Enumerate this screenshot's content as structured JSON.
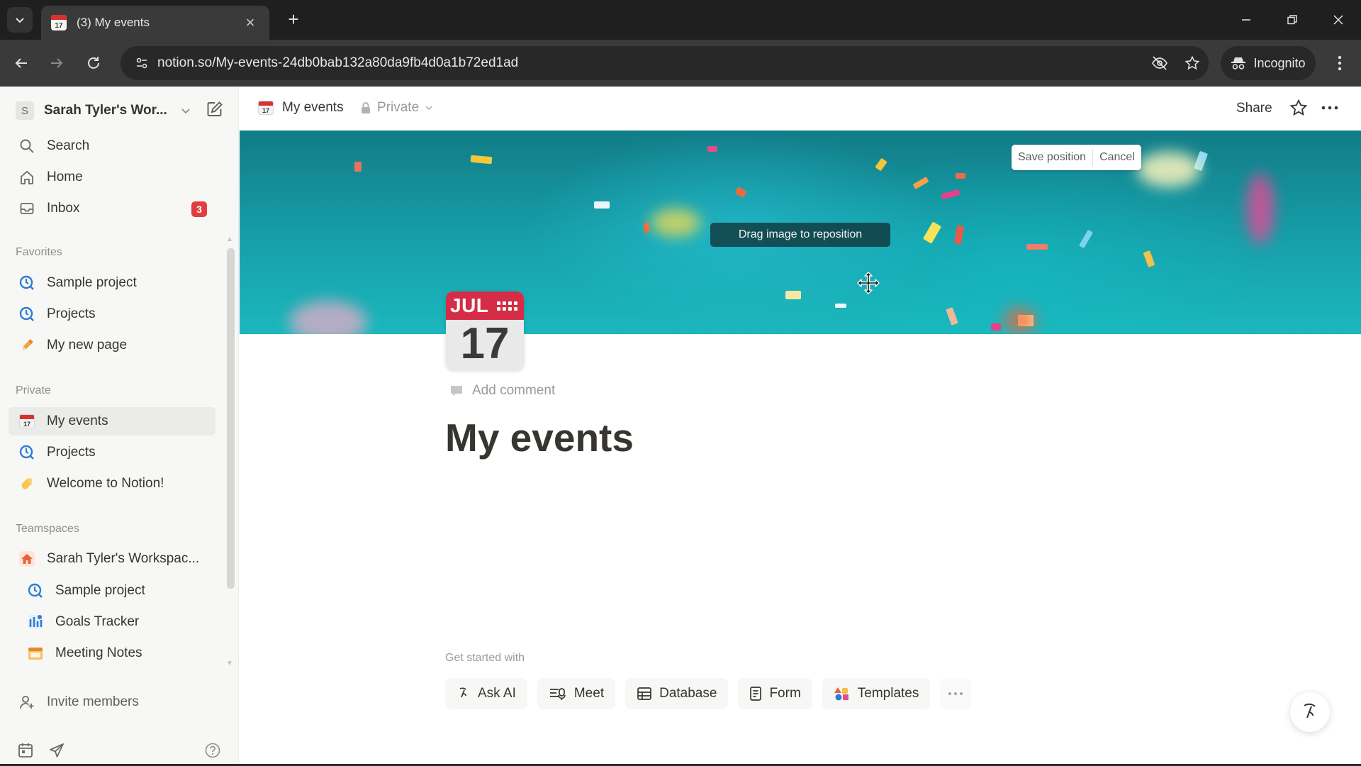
{
  "browser": {
    "tab_title": "(3) My events",
    "tab_favicon_day": "17",
    "url": "notion.so/My-events-24db0bab132a80da9fb4d0a1b72ed1ad",
    "incognito_label": "Incognito"
  },
  "sidebar": {
    "workspace_initial": "S",
    "workspace_name": "Sarah Tyler's Wor...",
    "top_items": [
      {
        "label": "Search",
        "icon": "search-icon"
      },
      {
        "label": "Home",
        "icon": "home-icon"
      },
      {
        "label": "Inbox",
        "icon": "inbox-icon",
        "badge": "3"
      }
    ],
    "favorites_label": "Favorites",
    "favorites": [
      {
        "label": "Sample project",
        "icon": "project-icon"
      },
      {
        "label": "Projects",
        "icon": "project-icon"
      },
      {
        "label": "My new page",
        "icon": "pencil-icon"
      }
    ],
    "private_label": "Private",
    "private": [
      {
        "label": "My events",
        "icon": "calendar-icon",
        "active": true
      },
      {
        "label": "Projects",
        "icon": "project-icon"
      },
      {
        "label": "Welcome to Notion!",
        "icon": "wave-icon"
      }
    ],
    "teamspaces_label": "Teamspaces",
    "teamspace_name": "Sarah Tyler's Workspac...",
    "teamspace_items": [
      {
        "label": "Sample project",
        "icon": "project-icon"
      },
      {
        "label": "Goals Tracker",
        "icon": "goals-icon"
      },
      {
        "label": "Meeting Notes",
        "icon": "notes-icon"
      }
    ],
    "invite_label": "Invite members"
  },
  "topbar": {
    "breadcrumb": "My events",
    "privacy": "Private",
    "share": "Share"
  },
  "cover": {
    "save_position": "Save position",
    "cancel": "Cancel",
    "drag_hint": "Drag image to reposition"
  },
  "page": {
    "icon_month": "JUL",
    "icon_day": "17",
    "add_comment": "Add comment",
    "title": "My events",
    "get_started": "Get started with",
    "chips": [
      "Ask AI",
      "Meet",
      "Database",
      "Form",
      "Templates"
    ]
  },
  "colors": {
    "accent_red": "#e03e3e",
    "cover_teal": "#16a0aa",
    "sidebar_bg": "#f7f7f5"
  }
}
